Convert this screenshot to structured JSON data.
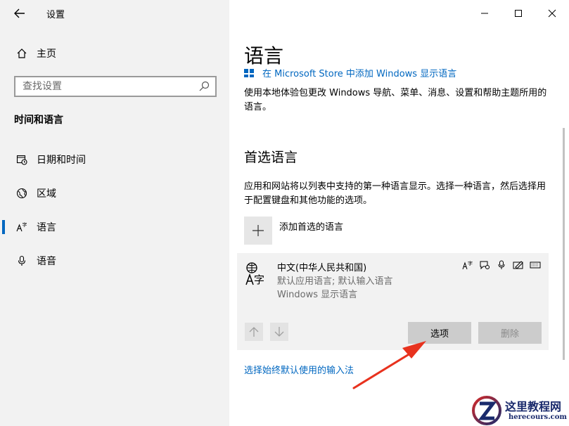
{
  "window": {
    "app_title": "设置",
    "controls": {
      "minimize": "minimize-icon",
      "maximize": "maximize-icon",
      "close": "close-icon"
    }
  },
  "sidebar": {
    "home_label": "主页",
    "search_placeholder": "查找设置",
    "section_title": "时间和语言",
    "items": [
      {
        "label": "日期和时间",
        "icon": "calendar-clock-icon"
      },
      {
        "label": "区域",
        "icon": "globe-icon"
      },
      {
        "label": "语言",
        "icon": "language-icon",
        "active": true
      },
      {
        "label": "语音",
        "icon": "microphone-icon"
      }
    ]
  },
  "main": {
    "title": "语言",
    "store_link": "在 Microsoft Store 中添加 Windows 显示语言",
    "description": "使用本地体验包更改 Windows 导航、菜单、消息、设置和帮助主题所用的语言。",
    "preferred_title": "首选语言",
    "preferred_description": "应用和网站将以列表中支持的第一种语言显示。选择一种语言，然后选择用于配置键盘和其他功能的选项。",
    "add_language_label": "添加首选的语言",
    "language_card": {
      "name": "中文(中华人民共和国)",
      "detail1": "默认应用语言; 默认输入语言",
      "detail2": "Windows 显示语言",
      "options_label": "选项",
      "remove_label": "删除"
    },
    "input_method_link": "选择始终默认使用的输入法"
  },
  "watermark": {
    "title": "这里教程网",
    "url": "herecours.com"
  },
  "colors": {
    "accent": "#0067c0",
    "annotation": "#e8321e"
  }
}
